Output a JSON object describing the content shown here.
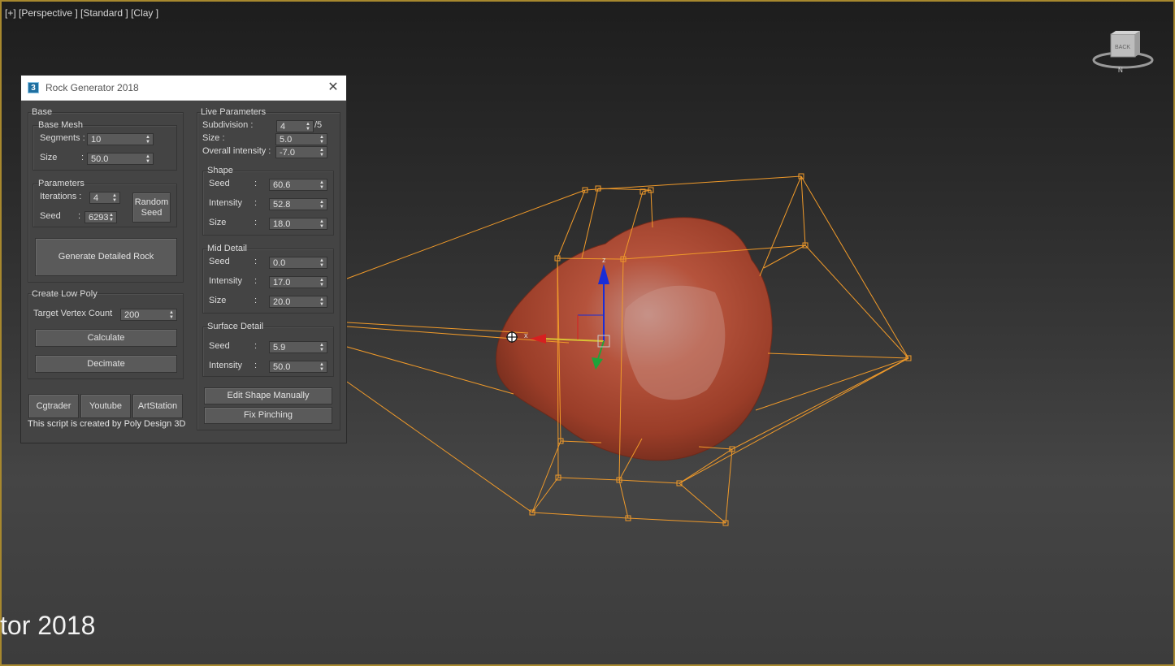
{
  "viewport": {
    "label": "[+] [Perspective ] [Standard ] [Clay ]",
    "bottom_caption": "tor 2018",
    "viewcube_label": "BACK",
    "axis_x_label": "x",
    "axis_z_label": "z",
    "colors": {
      "border": "#a7882e",
      "wireframe": "#f09a2a",
      "rock": "#b5533c"
    }
  },
  "dialog": {
    "title": "Rock Generator 2018",
    "app_icon": "3",
    "close_icon": "close-icon",
    "base": {
      "label": "Base",
      "base_mesh": {
        "label": "Base Mesh",
        "segments_label": "Segments :",
        "segments_value": "10",
        "size_label": "Size",
        "size_colon": ":",
        "size_value": "50.0"
      },
      "parameters": {
        "label": "Parameters",
        "iterations_label": "Iterations :",
        "iterations_value": "4",
        "seed_label": "Seed",
        "seed_colon": ":",
        "seed_value": "6293",
        "random_seed_line1": "Random",
        "random_seed_line2": "Seed"
      },
      "generate_button": "Generate Detailed Rock"
    },
    "low_poly": {
      "label": "Create Low Poly",
      "target_label": "Target Vertex Count",
      "target_value": "200",
      "calculate_button": "Calculate",
      "decimate_button": "Decimate"
    },
    "links": {
      "cgtrader": "Cgtrader",
      "youtube": "Youtube",
      "artstation": "ArtStation"
    },
    "footer": "This script is created by Poly Design 3D",
    "live": {
      "label": "Live Parameters",
      "subdivision_label": "Subdivision :",
      "subdivision_value": "4",
      "subdivision_max": "/5",
      "size_label": "Size :",
      "size_value": "5.0",
      "overall_label": "Overall intensity :",
      "overall_value": "-7.0",
      "colon": ":",
      "shape": {
        "label": "Shape",
        "seed_label": "Seed",
        "seed_value": "60.6",
        "intensity_label": "Intensity",
        "intensity_value": "52.8",
        "size_label": "Size",
        "size_value": "18.0"
      },
      "mid_detail": {
        "label": "Mid Detail",
        "seed_label": "Seed",
        "seed_value": "0.0",
        "intensity_label": "Intensity",
        "intensity_value": "17.0",
        "size_label": "Size",
        "size_value": "20.0"
      },
      "surface_detail": {
        "label": "Surface Detail",
        "seed_label": "Seed",
        "seed_value": "5.9",
        "intensity_label": "Intensity",
        "intensity_value": "50.0"
      },
      "edit_shape_button": "Edit Shape Manually",
      "fix_pinching_button": "Fix Pinching"
    }
  }
}
